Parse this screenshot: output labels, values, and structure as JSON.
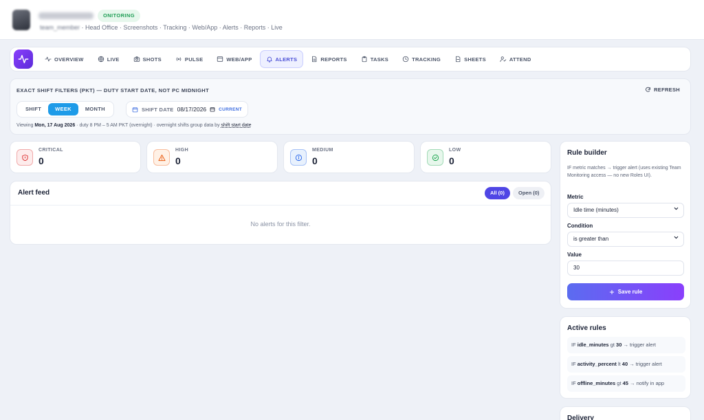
{
  "header": {
    "status_badge": "ONITORING",
    "breadcrumb_first": "team_member",
    "breadcrumb_rest": " · Head Office · Screenshots · Tracking · Web/App · Alerts · Reports · Live"
  },
  "nav": {
    "items": [
      {
        "label": "OVERVIEW",
        "icon": "activity-icon"
      },
      {
        "label": "LIVE",
        "icon": "globe-icon"
      },
      {
        "label": "SHOTS",
        "icon": "camera-icon"
      },
      {
        "label": "PULSE",
        "icon": "radio-icon"
      },
      {
        "label": "WEB/APP",
        "icon": "window-icon"
      },
      {
        "label": "ALERTS",
        "icon": "bell-icon",
        "active": true
      },
      {
        "label": "REPORTS",
        "icon": "file-icon"
      },
      {
        "label": "TASKS",
        "icon": "clipboard-icon"
      },
      {
        "label": "TRACKING",
        "icon": "clock-icon"
      },
      {
        "label": "SHEETS",
        "icon": "sheet-icon"
      },
      {
        "label": "ATTEND",
        "icon": "user-check-icon"
      }
    ]
  },
  "filters": {
    "title": "EXACT SHIFT FILTERS (PKT) — DUTY START DATE, NOT PC MIDNIGHT",
    "refresh_label": "REFRESH",
    "modes": [
      "SHIFT",
      "WEEK",
      "MONTH"
    ],
    "active_mode": "WEEK",
    "date_label": "SHIFT DATE",
    "date_value": "08/17/2026",
    "current_label": "CURRENT",
    "viewing_prefix": "Viewing ",
    "viewing_date": "Mon, 17 Aug 2026",
    "viewing_mid": " · duty 8 PM – 5 AM PKT (overnight) · overnight shifts group data by ",
    "viewing_link": "shift start date"
  },
  "stats": [
    {
      "label": "CRITICAL",
      "value": "0",
      "color": "#dc2626",
      "bg": "#fdecec",
      "icon": "shield-icon"
    },
    {
      "label": "HIGH",
      "value": "0",
      "color": "#ea580c",
      "bg": "#fff1e6",
      "icon": "warning-icon"
    },
    {
      "label": "MEDIUM",
      "value": "0",
      "color": "#2563eb",
      "bg": "#e8f1fd",
      "icon": "info-icon"
    },
    {
      "label": "LOW",
      "value": "0",
      "color": "#16a34a",
      "bg": "#e7f7ec",
      "icon": "check-circle-icon"
    }
  ],
  "feed": {
    "title": "Alert feed",
    "all_label": "All (0)",
    "open_label": "Open (0)",
    "empty_text": "No alerts for this filter."
  },
  "rule_builder": {
    "title": "Rule builder",
    "description": "IF metric matches → trigger alert (uses existing Team Monitoring access — no new Roles UI).",
    "metric_label": "Metric",
    "metric_value": "Idle time (minutes)",
    "condition_label": "Condition",
    "condition_value": "is greater than",
    "value_label": "Value",
    "value_value": "30",
    "save_label": "Save rule"
  },
  "active_rules": {
    "title": "Active rules",
    "rules": [
      {
        "prefix": "IF ",
        "metric": "idle_minutes",
        "op": " gt ",
        "value": "30",
        "suffix": " → trigger alert"
      },
      {
        "prefix": "IF ",
        "metric": "activity_percent",
        "op": " lt ",
        "value": "40",
        "suffix": " → trigger alert"
      },
      {
        "prefix": "IF ",
        "metric": "offline_minutes",
        "op": " gt ",
        "value": "45",
        "suffix": " → notify in app"
      }
    ]
  },
  "delivery": {
    "title": "Delivery"
  }
}
